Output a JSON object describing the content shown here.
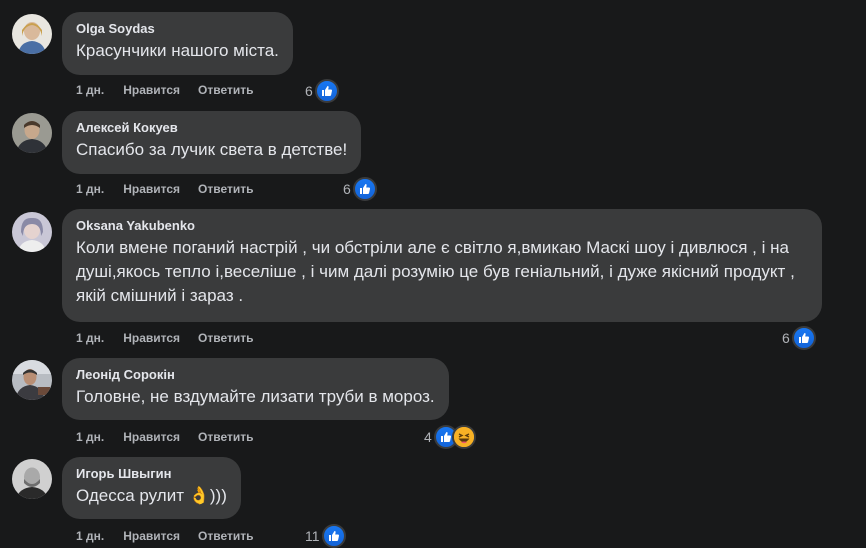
{
  "actions": {
    "like_label": "Нравится",
    "reply_label": "Ответить"
  },
  "comments": [
    {
      "author": "Olga Soydas",
      "text": "Красунчики нашого міста.",
      "time": "1 дн.",
      "reactions": "6",
      "reaction_icons": [
        "like-icon"
      ]
    },
    {
      "author": "Алексей Кокуев",
      "text": "Спасибо за лучик света в детстве!",
      "time": "1 дн.",
      "reactions": "6",
      "reaction_icons": [
        "like-icon"
      ]
    },
    {
      "author": "Oksana Yakubenko",
      "text": "Коли вмене поганий настрій , чи обстріли але є світло я,вмикаю Маскі шоу і дивлюся , і на душі,якось тепло і,веселіше , і чим далі розумію це був геніальний, і дуже якісний продукт , якій смішний і зараз .",
      "time": "1 дн.",
      "reactions": "6",
      "reaction_icons": [
        "like-icon"
      ]
    },
    {
      "author": "Леонід Сорокін",
      "text": "Головне, не вздумайте лизати труби в мороз.",
      "time": "1 дн.",
      "reactions": "4",
      "reaction_icons": [
        "like-icon",
        "haha-icon"
      ]
    },
    {
      "author": "Игорь Швыгин",
      "text": "Одесса рулит 👌)))",
      "time": "1 дн.",
      "reactions": "11",
      "reaction_icons": [
        "like-icon"
      ]
    }
  ],
  "colors": {
    "background": "#18191a",
    "bubble": "#3a3b3c",
    "like_blue": "#1877f2",
    "meta_text": "#b0b3b8"
  }
}
